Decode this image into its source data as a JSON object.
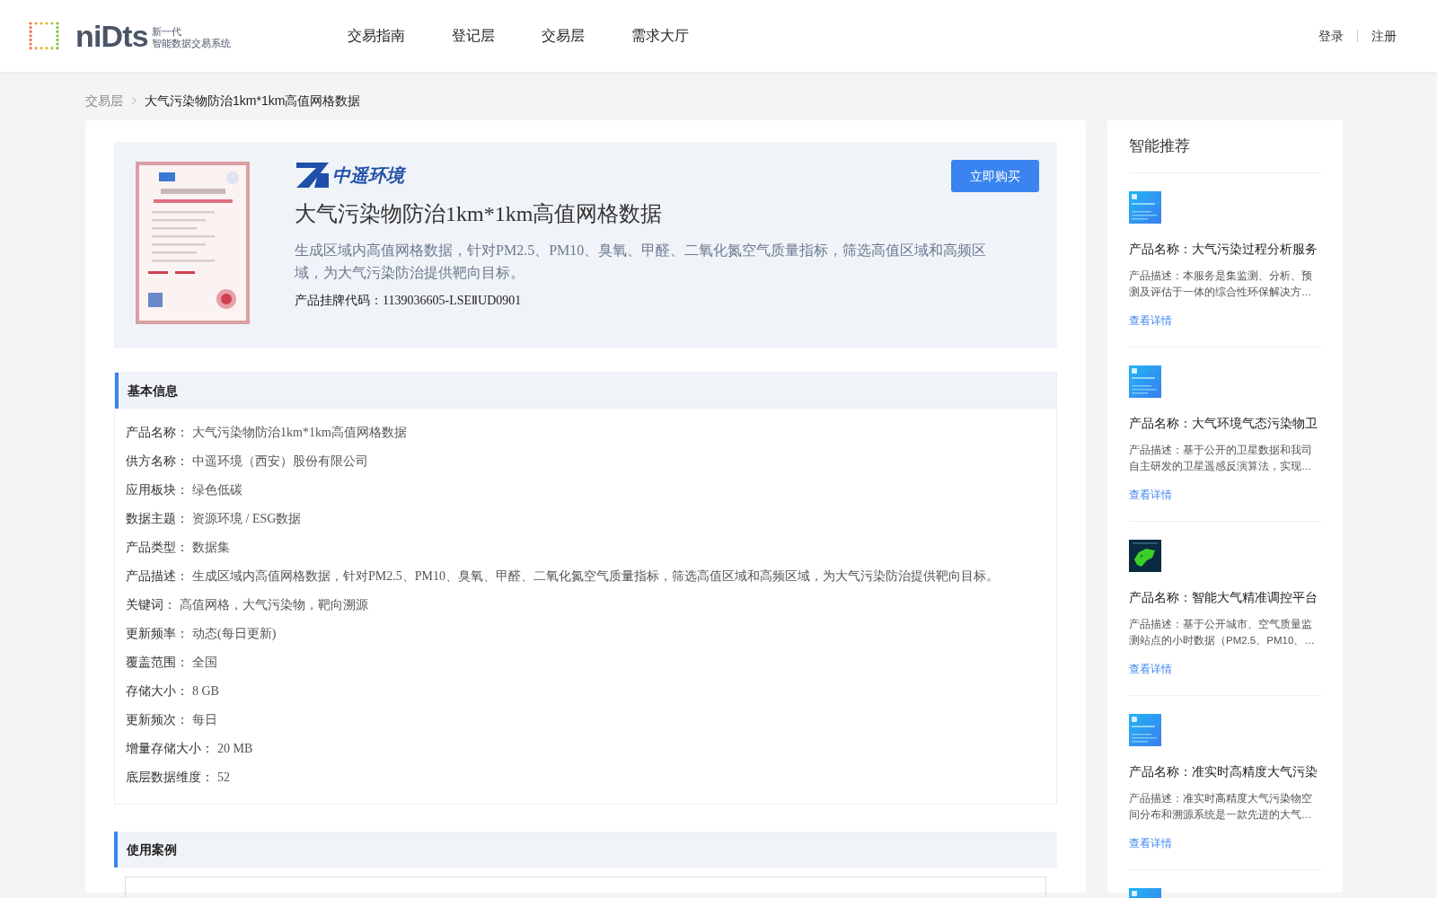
{
  "header": {
    "logo_text": "niDts",
    "logo_subtitle_1": "新一代",
    "logo_subtitle_2": "智能数据交易系统",
    "nav": [
      "交易指南",
      "登记层",
      "交易层",
      "需求大厅"
    ],
    "auth": [
      "登录",
      "注册"
    ]
  },
  "breadcrumb": [
    "交易层",
    "大气污染物防治1km*1km高值网格数据"
  ],
  "product": {
    "brand": "中遥环境",
    "title": "大气污染物防治1km*1km高值网格数据",
    "description": "生成区域内高值网格数据，针对PM2.5、PM10、臭氧、甲醛、二氧化氮空气质量指标，筛选高值区域和高频区域，为大气污染防治提供靶向目标。",
    "code_label": "产品挂牌代码：",
    "code": "1139036605-LSEⅡUD0901",
    "buy_button": "立即购买"
  },
  "basic_info": {
    "title": "基本信息",
    "rows": [
      {
        "label": "产品名称：",
        "value": "大气污染物防治1km*1km高值网格数据"
      },
      {
        "label": "供方名称：",
        "value": "中遥环境（西安）股份有限公司"
      },
      {
        "label": "应用板块：",
        "value": "绿色低碳"
      },
      {
        "label": "数据主题：",
        "value": "资源环境 / ESG数据"
      },
      {
        "label": "产品类型：",
        "value": "数据集"
      },
      {
        "label": "产品描述：",
        "value": "生成区域内高值网格数据，针对PM2.5、PM10、臭氧、甲醛、二氧化氮空气质量指标，筛选高值区域和高频区域，为大气污染防治提供靶向目标。"
      },
      {
        "label": "关键词：",
        "value": "高值网格，大气污染物，靶向溯源"
      },
      {
        "label": "更新频率：",
        "value": "动态(每日更新)"
      },
      {
        "label": "覆盖范围：",
        "value": "全国"
      },
      {
        "label": "存储大小：",
        "value": "8 GB"
      },
      {
        "label": "更新频次：",
        "value": "每日"
      },
      {
        "label": "增量存储大小：",
        "value": "20 MB"
      },
      {
        "label": "底层数据维度：",
        "value": "52"
      }
    ]
  },
  "use_cases": {
    "title": "使用案例"
  },
  "recommend": {
    "title": "智能推荐",
    "items": [
      {
        "kind": "picture",
        "name": "产品名称：大气污染过程分析服务",
        "desc": "产品描述：本服务是集监测、分析、预测及评估于一体的综合性环保解决方…",
        "link": "查看详情"
      },
      {
        "kind": "picture",
        "name": "产品名称：大气环境气态污染物卫",
        "desc": "产品描述：基于公开的卫星数据和我司自主研发的卫星遥感反演算法，实现…",
        "link": "查看详情"
      },
      {
        "kind": "picture",
        "name": "产品名称：智能大气精准调控平台",
        "desc": "产品描述：基于公开城市、空气质量监测站点的小时数据（PM2.5、PM10、…",
        "link": "查看详情"
      },
      {
        "kind": "picture",
        "name": "产品名称：准实时高精度大气污染",
        "desc": "产品描述：准实时高精度大气污染物空间分布和溯源系统是一款先进的大气…",
        "link": "查看详情"
      },
      {
        "kind": "picture"
      }
    ]
  }
}
